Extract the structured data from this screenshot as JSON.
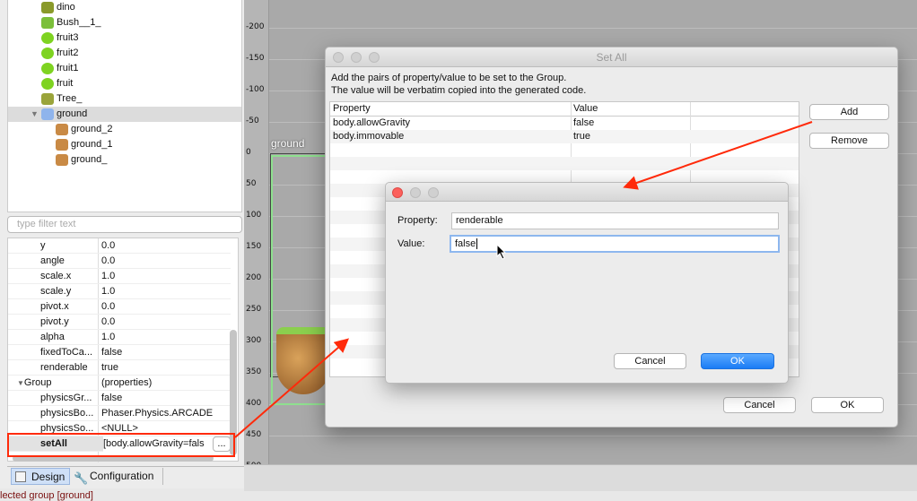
{
  "tree": {
    "items": [
      {
        "label": "dino",
        "icon": "dino-icon",
        "indent": 1
      },
      {
        "label": "Bush__1_",
        "icon": "bush-icon",
        "indent": 1
      },
      {
        "label": "fruit3",
        "icon": "fruit-icon",
        "indent": 1
      },
      {
        "label": "fruit2",
        "icon": "fruit-icon",
        "indent": 1
      },
      {
        "label": "fruit1",
        "icon": "fruit-icon",
        "indent": 1
      },
      {
        "label": "fruit",
        "icon": "fruit-icon",
        "indent": 1
      },
      {
        "label": "Tree_",
        "icon": "tree-icon",
        "indent": 1
      },
      {
        "label": "ground",
        "icon": "group-icon",
        "indent": 1,
        "selected": true,
        "expanded": true
      },
      {
        "label": "ground_2",
        "icon": "ground-tile-icon",
        "indent": 2
      },
      {
        "label": "ground_1",
        "icon": "ground-tile-icon",
        "indent": 2
      },
      {
        "label": "ground_",
        "icon": "ground-tile-icon",
        "indent": 2
      }
    ]
  },
  "filter": {
    "placeholder": "type filter text"
  },
  "properties": {
    "rows": [
      {
        "name": "y",
        "value": "0.0"
      },
      {
        "name": "angle",
        "value": "0.0"
      },
      {
        "name": "scale.x",
        "value": "1.0"
      },
      {
        "name": "scale.y",
        "value": "1.0"
      },
      {
        "name": "pivot.x",
        "value": "0.0"
      },
      {
        "name": "pivot.y",
        "value": "0.0"
      },
      {
        "name": "alpha",
        "value": "1.0"
      },
      {
        "name": "fixedToCa...",
        "value": "false"
      },
      {
        "name": "renderable",
        "value": "true"
      },
      {
        "name": "Group",
        "value": "(properties)",
        "section": true
      },
      {
        "name": "physicsGr...",
        "value": "false"
      },
      {
        "name": "physicsBo...",
        "value": "Phaser.Physics.ARCADE"
      },
      {
        "name": "physicsSo...",
        "value": "<NULL>"
      },
      {
        "name": "setAll",
        "value": "[body.allowGravity=fals",
        "highlight": true
      }
    ],
    "ellipsis": "..."
  },
  "tabs": [
    {
      "label": "Design",
      "active": true
    },
    {
      "label": "Configuration"
    }
  ],
  "status": "lected group [ground]",
  "canvas": {
    "ruler_ticks": [
      "-200",
      "-150",
      "-100",
      "-50",
      "0",
      "50",
      "100",
      "150",
      "200",
      "250",
      "300",
      "350",
      "400",
      "450",
      "500"
    ],
    "group_label": "ground"
  },
  "setAll": {
    "title": "Set All",
    "desc1": "Add the pairs of property/value to be set to the Group.",
    "desc2": "The value will be verbatim copied into the generated code.",
    "columns": [
      "Property",
      "Value"
    ],
    "rows": [
      {
        "property": "body.allowGravity",
        "value": "false"
      },
      {
        "property": "body.immovable",
        "value": "true"
      }
    ],
    "add": "Add",
    "remove": "Remove",
    "cancel": "Cancel",
    "ok": "OK"
  },
  "addDialog": {
    "property_label": "Property:",
    "property_value": "renderable",
    "value_label": "Value:",
    "value_value": "false",
    "cancel": "Cancel",
    "ok": "OK"
  },
  "colors": {
    "annotation": "#ff2a0a",
    "accent": "#1a7cf5"
  }
}
